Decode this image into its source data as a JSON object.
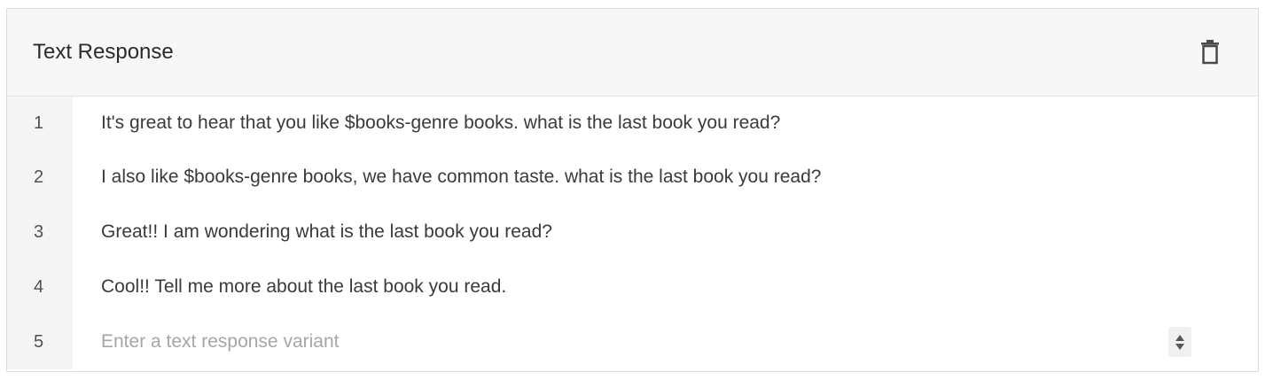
{
  "card": {
    "title": "Text Response",
    "delete_icon": "trash-icon"
  },
  "responses": [
    {
      "index": "1",
      "text": "It's great to hear that you like $books-genre books. what is the last book you read?"
    },
    {
      "index": "2",
      "text": "I also like $books-genre books, we have common taste. what is the last book you read?"
    },
    {
      "index": "3",
      "text": "Great!! I am wondering what is the last book you read?"
    },
    {
      "index": "4",
      "text": "Cool!! Tell me more about the last book you read."
    }
  ],
  "new_variant": {
    "index": "5",
    "value": "",
    "placeholder": "Enter a text response variant",
    "stepper_icon": "stepper-icon"
  }
}
